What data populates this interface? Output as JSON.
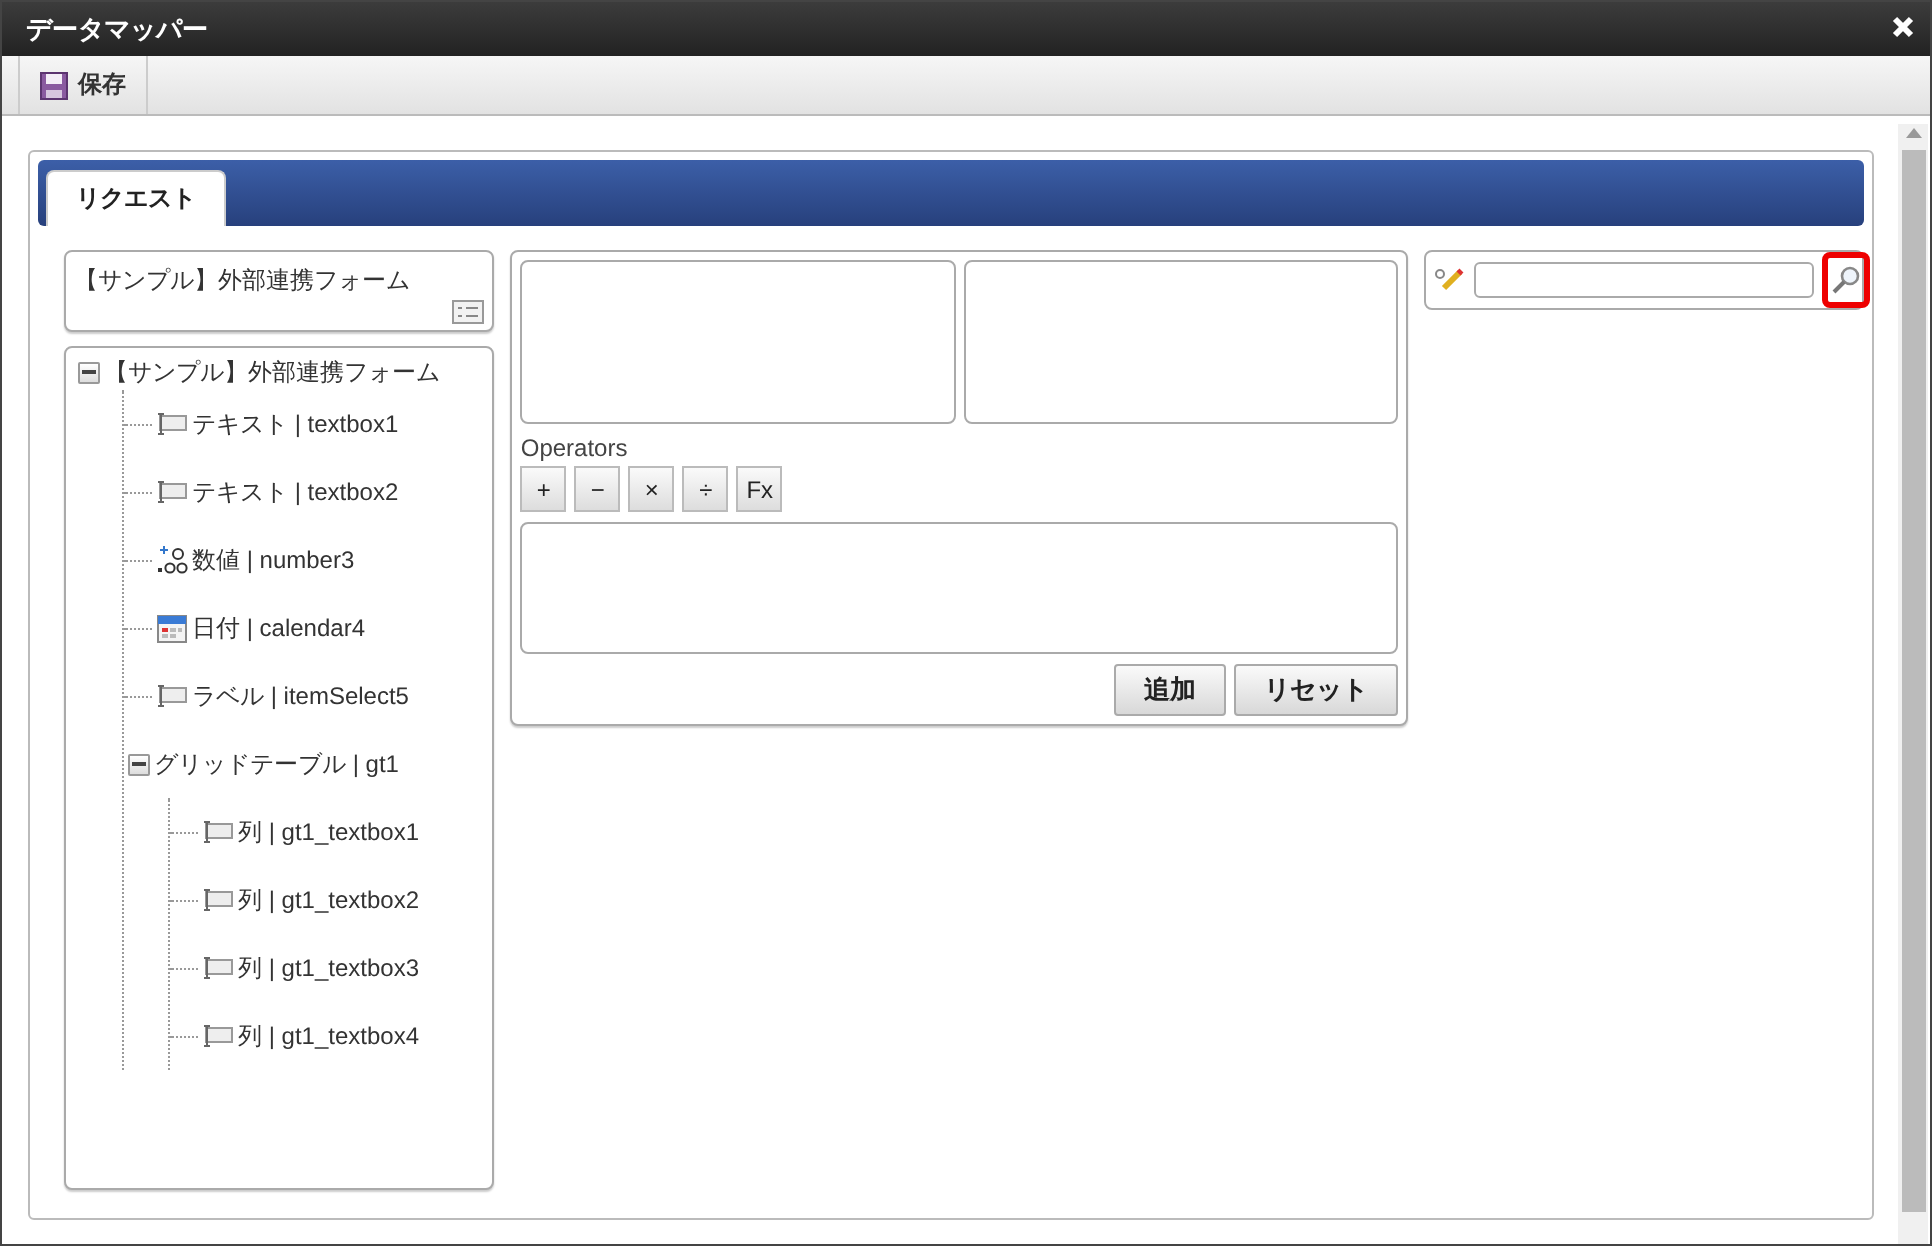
{
  "window": {
    "title": "データマッパー"
  },
  "toolbar": {
    "buttons": [
      {
        "label": "保存",
        "kind": "save"
      }
    ]
  },
  "tabs": [
    {
      "label": "リクエスト",
      "selected": true
    }
  ],
  "form_header": {
    "title": "【サンプル】外部連携フォーム"
  },
  "tree": {
    "label": "【サンプル】外部連携フォーム",
    "expanded": true,
    "children": [
      {
        "label": "テキスト | textbox1",
        "kind": "textbox"
      },
      {
        "label": "テキスト | textbox2",
        "kind": "textbox"
      },
      {
        "label": "数値 | number3",
        "kind": "number"
      },
      {
        "label": "日付 | calendar4",
        "kind": "calendar"
      },
      {
        "label": "ラベル | itemSelect5",
        "kind": "textbox"
      },
      {
        "label": "グリッドテーブル | gt1",
        "kind": "grid",
        "expanded": true,
        "children": [
          {
            "label": "列 | gt1_textbox1",
            "kind": "textbox"
          },
          {
            "label": "列 | gt1_textbox2",
            "kind": "textbox"
          },
          {
            "label": "列 | gt1_textbox3",
            "kind": "textbox"
          },
          {
            "label": "列 | gt1_textbox4",
            "kind": "textbox"
          }
        ]
      }
    ]
  },
  "operators": {
    "label": "Operators",
    "buttons": [
      "+",
      "−",
      "×",
      "÷",
      "Fx"
    ]
  },
  "actions": [
    "追加",
    "リセット"
  ],
  "search": {
    "highlighted": true
  }
}
